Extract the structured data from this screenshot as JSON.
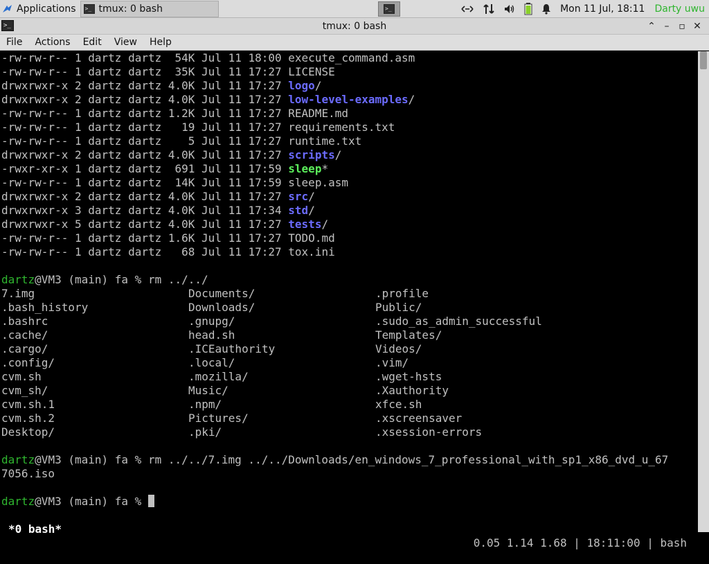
{
  "panel": {
    "applications_label": "Applications",
    "task_label": "tmux: 0 bash",
    "clock": "Mon 11 Jul, 18:11",
    "user": "Darty uwu",
    "tray_icons": [
      "network-arrows-icon",
      "transfer-icon",
      "volume-icon",
      "battery-icon",
      "notification-bell-icon"
    ]
  },
  "window": {
    "title": "tmux: 0 bash",
    "buttons": [
      "▲",
      "–",
      "□",
      "✕"
    ]
  },
  "menu": [
    "File",
    "Actions",
    "Edit",
    "View",
    "Help"
  ],
  "listing": [
    {
      "perm": "-rw-rw-r--",
      "links": "1",
      "owner": "dartz",
      "group": "dartz",
      "size": " 54K",
      "date": "Jul 11 18:00",
      "name": "execute_command.asm",
      "suffix": "",
      "kind": "file"
    },
    {
      "perm": "-rw-rw-r--",
      "links": "1",
      "owner": "dartz",
      "group": "dartz",
      "size": " 35K",
      "date": "Jul 11 17:27",
      "name": "LICENSE",
      "suffix": "",
      "kind": "file"
    },
    {
      "perm": "drwxrwxr-x",
      "links": "2",
      "owner": "dartz",
      "group": "dartz",
      "size": "4.0K",
      "date": "Jul 11 17:27",
      "name": "logo",
      "suffix": "/",
      "kind": "dir"
    },
    {
      "perm": "drwxrwxr-x",
      "links": "2",
      "owner": "dartz",
      "group": "dartz",
      "size": "4.0K",
      "date": "Jul 11 17:27",
      "name": "low-level-examples",
      "suffix": "/",
      "kind": "dir"
    },
    {
      "perm": "-rw-rw-r--",
      "links": "1",
      "owner": "dartz",
      "group": "dartz",
      "size": "1.2K",
      "date": "Jul 11 17:27",
      "name": "README.md",
      "suffix": "",
      "kind": "file"
    },
    {
      "perm": "-rw-rw-r--",
      "links": "1",
      "owner": "dartz",
      "group": "dartz",
      "size": "  19",
      "date": "Jul 11 17:27",
      "name": "requirements.txt",
      "suffix": "",
      "kind": "file"
    },
    {
      "perm": "-rw-rw-r--",
      "links": "1",
      "owner": "dartz",
      "group": "dartz",
      "size": "   5",
      "date": "Jul 11 17:27",
      "name": "runtime.txt",
      "suffix": "",
      "kind": "file"
    },
    {
      "perm": "drwxrwxr-x",
      "links": "2",
      "owner": "dartz",
      "group": "dartz",
      "size": "4.0K",
      "date": "Jul 11 17:27",
      "name": "scripts",
      "suffix": "/",
      "kind": "dir"
    },
    {
      "perm": "-rwxr-xr-x",
      "links": "1",
      "owner": "dartz",
      "group": "dartz",
      "size": " 691",
      "date": "Jul 11 17:59",
      "name": "sleep",
      "suffix": "*",
      "kind": "exe"
    },
    {
      "perm": "-rw-rw-r--",
      "links": "1",
      "owner": "dartz",
      "group": "dartz",
      "size": " 14K",
      "date": "Jul 11 17:59",
      "name": "sleep.asm",
      "suffix": "",
      "kind": "file"
    },
    {
      "perm": "drwxrwxr-x",
      "links": "2",
      "owner": "dartz",
      "group": "dartz",
      "size": "4.0K",
      "date": "Jul 11 17:27",
      "name": "src",
      "suffix": "/",
      "kind": "dir"
    },
    {
      "perm": "drwxrwxr-x",
      "links": "3",
      "owner": "dartz",
      "group": "dartz",
      "size": "4.0K",
      "date": "Jul 11 17:34",
      "name": "std",
      "suffix": "/",
      "kind": "dir"
    },
    {
      "perm": "drwxrwxr-x",
      "links": "5",
      "owner": "dartz",
      "group": "dartz",
      "size": "4.0K",
      "date": "Jul 11 17:27",
      "name": "tests",
      "suffix": "/",
      "kind": "dir"
    },
    {
      "perm": "-rw-rw-r--",
      "links": "1",
      "owner": "dartz",
      "group": "dartz",
      "size": "1.6K",
      "date": "Jul 11 17:27",
      "name": "TODO.md",
      "suffix": "",
      "kind": "file"
    },
    {
      "perm": "-rw-rw-r--",
      "links": "1",
      "owner": "dartz",
      "group": "dartz",
      "size": "  68",
      "date": "Jul 11 17:27",
      "name": "tox.ini",
      "suffix": "",
      "kind": "file"
    }
  ],
  "prompt": {
    "user": "dartz",
    "rest": "@VM3 (main) fa % "
  },
  "commands": {
    "first": "rm ../../",
    "second_line1": "rm ../../7.img ../../Downloads/en_windows_7_professional_with_sp1_x86_dvd_u_67",
    "second_line2": "7056.iso"
  },
  "completions": [
    [
      "7.img",
      "Documents/",
      ".profile"
    ],
    [
      ".bash_history",
      "Downloads/",
      "Public/"
    ],
    [
      ".bashrc",
      ".gnupg/",
      ".sudo_as_admin_successful"
    ],
    [
      ".cache/",
      "head.sh",
      "Templates/"
    ],
    [
      ".cargo/",
      ".ICEauthority",
      "Videos/"
    ],
    [
      ".config/",
      ".local/",
      ".vim/"
    ],
    [
      "cvm.sh",
      ".mozilla/",
      ".wget-hsts"
    ],
    [
      "cvm_sh/",
      "Music/",
      ".Xauthority"
    ],
    [
      "cvm.sh.1",
      ".npm/",
      "xfce.sh"
    ],
    [
      "cvm.sh.2",
      "Pictures/",
      ".xscreensaver"
    ],
    [
      "Desktop/",
      ".pki/",
      ".xsession-errors"
    ]
  ],
  "tmux_status": {
    "window": "*0 bash*",
    "right": "0.05 1.14 1.68 | 18:11:00 | bash"
  },
  "colors": {
    "dir": "#6b6bff",
    "exe": "#5cf05c",
    "prompt_user": "#2fb52f",
    "text": "#c0c0c0"
  }
}
